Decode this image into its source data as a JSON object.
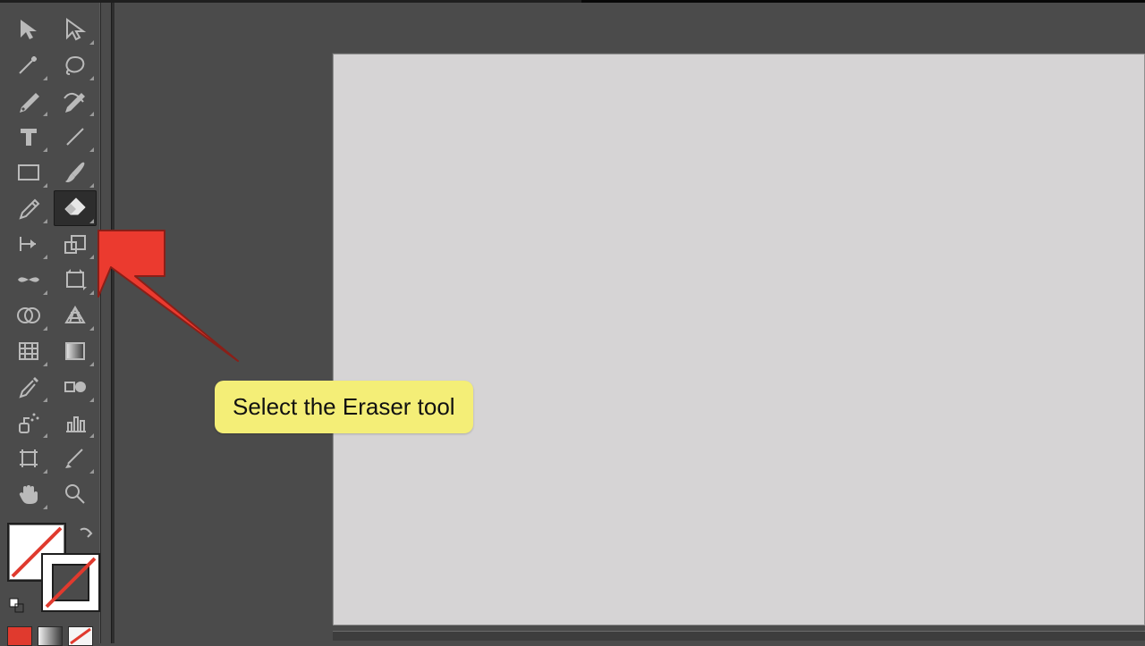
{
  "annotation": {
    "callout_text": "Select the Eraser tool"
  },
  "toolbar": {
    "tools": [
      {
        "name": "selection-tool"
      },
      {
        "name": "direct-selection-tool"
      },
      {
        "name": "magic-wand-tool"
      },
      {
        "name": "lasso-tool"
      },
      {
        "name": "pen-tool"
      },
      {
        "name": "curvature-tool"
      },
      {
        "name": "type-tool"
      },
      {
        "name": "line-segment-tool"
      },
      {
        "name": "rectangle-tool"
      },
      {
        "name": "paintbrush-tool"
      },
      {
        "name": "pencil-tool"
      },
      {
        "name": "eraser-tool"
      },
      {
        "name": "rotate-tool"
      },
      {
        "name": "scale-tool"
      },
      {
        "name": "width-tool"
      },
      {
        "name": "free-transform-tool"
      },
      {
        "name": "shape-builder-tool"
      },
      {
        "name": "perspective-grid-tool"
      },
      {
        "name": "mesh-tool"
      },
      {
        "name": "gradient-tool"
      },
      {
        "name": "eyedropper-tool"
      },
      {
        "name": "blend-tool"
      },
      {
        "name": "symbol-sprayer-tool"
      },
      {
        "name": "column-graph-tool"
      },
      {
        "name": "artboard-tool"
      },
      {
        "name": "slice-tool"
      },
      {
        "name": "hand-tool"
      },
      {
        "name": "zoom-tool"
      }
    ],
    "active_tool": "eraser-tool"
  },
  "color": {
    "fill": "#ffffff",
    "fill_none_slash": true,
    "stroke": "#ffffff",
    "stroke_none_slash": true,
    "modes": [
      "solid",
      "gradient",
      "none"
    ]
  }
}
